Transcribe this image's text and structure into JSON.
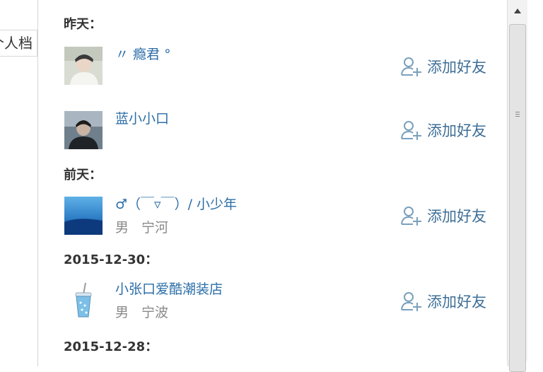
{
  "left_tab": {
    "label": "个人档"
  },
  "groups": [
    {
      "date": "昨天：",
      "users": [
        {
          "name": "〃 瘾君 °",
          "gender": "",
          "location": "",
          "avatar": "boy-white-shirt"
        },
        {
          "name": "蓝小小口",
          "gender": "",
          "location": "",
          "avatar": "person-dark"
        }
      ]
    },
    {
      "date": "前天：",
      "users": [
        {
          "name": "♂（￣▿￣）/ 小少年",
          "gender": "男",
          "location": "宁河",
          "avatar": "blue-sky"
        }
      ]
    },
    {
      "date": "2015-12-30：",
      "users": [
        {
          "name": "小张口爱酷潮装店",
          "gender": "男",
          "location": "宁波",
          "avatar": "cup-drink"
        }
      ]
    },
    {
      "date": "2015-12-28：",
      "users": []
    }
  ],
  "add_friend_label": "添加好友",
  "colors": {
    "link": "#2b6ea8",
    "add_button": "#3e6f97",
    "muted": "#8a8a8a"
  }
}
